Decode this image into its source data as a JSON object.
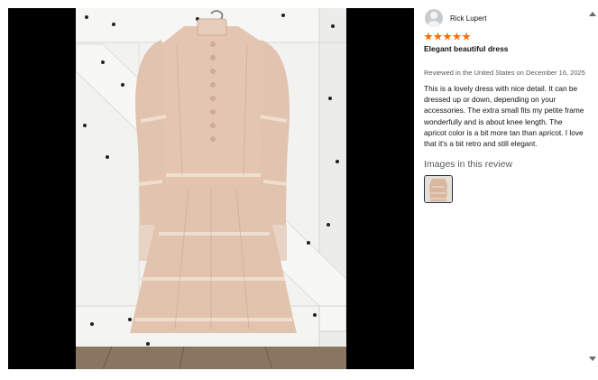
{
  "review": {
    "reviewer_name": "Rick Lupert",
    "rating": 5,
    "title": "Elegant beautiful dress",
    "date_line": "Reviewed in the United States on December 16, 2025",
    "body": "This is a lovely dress with nice detail. It can be dressed up or down, depending on your accessories. The extra small fits my petite frame wonderfully and is about knee length. The apricot color is a bit more tan than apricot. I love that it's a bit retro and still elegant.",
    "images_heading": "Images in this review"
  },
  "colors": {
    "star": "#ff6d00",
    "stage_background": "#000000",
    "dress": "#e3c5b1"
  },
  "icons": {
    "avatar": "default-user-avatar-icon",
    "scroll_up": "scroll-up-arrow-icon",
    "scroll_down": "scroll-down-arrow-icon"
  }
}
